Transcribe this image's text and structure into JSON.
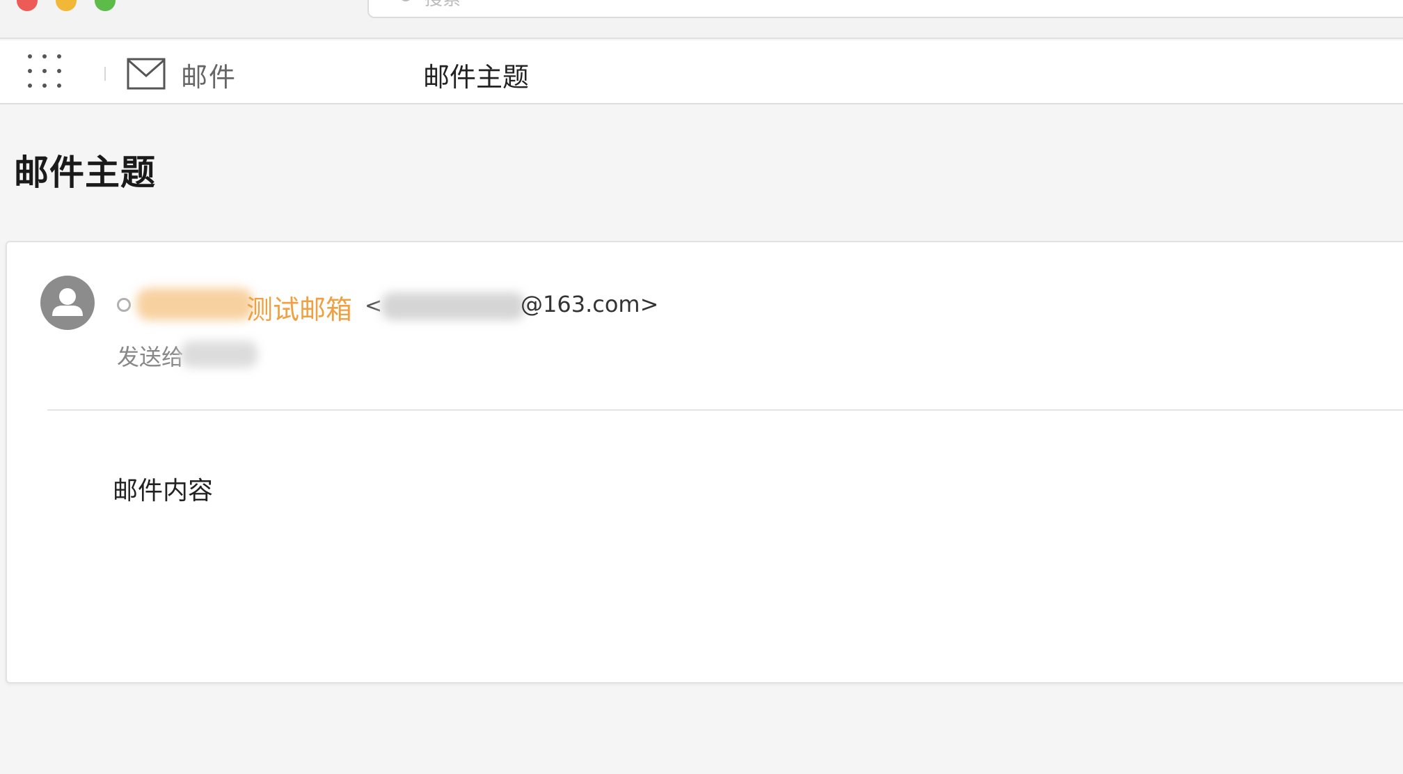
{
  "window": {
    "search_placeholder": "搜索"
  },
  "toolbar": {
    "app_name": "邮件",
    "subject": "邮件主题"
  },
  "message": {
    "subject": "邮件主题",
    "sender_name": "测试邮箱",
    "sender_address_open": "<",
    "sender_domain": "@163.com>",
    "send_to_label": "发送给",
    "body": "邮件内容"
  },
  "colors": {
    "sender_accent": "#f0a040",
    "background": "#f5f5f5",
    "card": "#ffffff"
  }
}
